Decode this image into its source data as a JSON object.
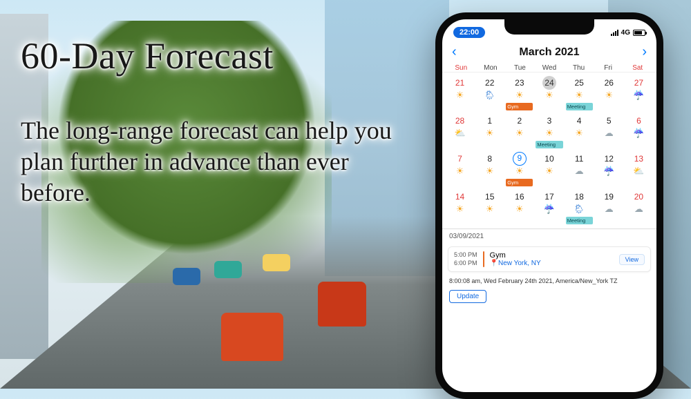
{
  "marketing": {
    "headline": "60-Day Forecast",
    "subhead": "The long-range forecast can help you plan further in advance than ever before."
  },
  "status_bar": {
    "time": "22:00",
    "network": "4G"
  },
  "calendar": {
    "month_label": "March 2021",
    "dow": [
      "Sun",
      "Mon",
      "Tue",
      "Wed",
      "Thu",
      "Fri",
      "Sat"
    ],
    "today": 24,
    "selected": 9,
    "weeks": [
      [
        {
          "n": 21,
          "red": true,
          "wx": "sun"
        },
        {
          "n": 22,
          "wx": "rain-sun"
        },
        {
          "n": 23,
          "wx": "sun",
          "ev": {
            "label": "Gym",
            "kind": "gym"
          }
        },
        {
          "n": 24,
          "wx": "sun",
          "today": true
        },
        {
          "n": 25,
          "wx": "sun",
          "ev": {
            "label": "Meeting",
            "kind": "meeting"
          }
        },
        {
          "n": 26,
          "wx": "sun"
        },
        {
          "n": 27,
          "red": true,
          "wx": "rain"
        }
      ],
      [
        {
          "n": 28,
          "red": true,
          "wx": "cloud-sun"
        },
        {
          "n": 1,
          "wx": "sun"
        },
        {
          "n": 2,
          "wx": "sun"
        },
        {
          "n": 3,
          "wx": "sun",
          "ev": {
            "label": "Meeting",
            "kind": "meeting"
          }
        },
        {
          "n": 4,
          "wx": "sun"
        },
        {
          "n": 5,
          "wx": "cloud"
        },
        {
          "n": 6,
          "red": true,
          "wx": "rain"
        }
      ],
      [
        {
          "n": 7,
          "red": true,
          "wx": "sun"
        },
        {
          "n": 8,
          "wx": "sun"
        },
        {
          "n": 9,
          "wx": "sun",
          "selected": true,
          "ev": {
            "label": "Gym",
            "kind": "gym"
          }
        },
        {
          "n": 10,
          "wx": "sun"
        },
        {
          "n": 11,
          "wx": "cloud"
        },
        {
          "n": 12,
          "wx": "rain"
        },
        {
          "n": 13,
          "red": true,
          "wx": "cloud-sun"
        }
      ],
      [
        {
          "n": 14,
          "red": true,
          "wx": "sun"
        },
        {
          "n": 15,
          "wx": "sun"
        },
        {
          "n": 16,
          "wx": "sun"
        },
        {
          "n": 17,
          "wx": "rain"
        },
        {
          "n": 18,
          "wx": "rain-sun",
          "ev": {
            "label": "Meeting",
            "kind": "meeting"
          }
        },
        {
          "n": 19,
          "wx": "cloud"
        },
        {
          "n": 20,
          "red": true,
          "wx": "cloud"
        }
      ]
    ]
  },
  "detail": {
    "date": "03/09/2021",
    "start": "5:00 PM",
    "end": "6:00 PM",
    "title": "Gym",
    "location": "New York, NY",
    "view_label": "View",
    "clock_line": "8:00:08 am, Wed February 24th 2021, America/New_York TZ",
    "update_label": "Update"
  },
  "icons": {
    "sun": "☀",
    "cloud": "☁",
    "rain": "☔",
    "rain-sun": "🌦",
    "cloud-sun": "⛅"
  }
}
